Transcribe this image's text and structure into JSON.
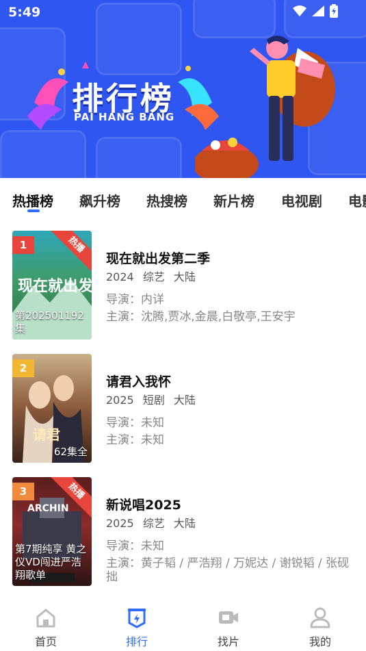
{
  "status_bar": {
    "time": "5:49"
  },
  "banner": {
    "title": "排行榜",
    "subtitle": "PAI HANG BANG"
  },
  "tabs": [
    {
      "label": "热播榜"
    },
    {
      "label": "飙升榜"
    },
    {
      "label": "热搜榜"
    },
    {
      "label": "新片榜"
    },
    {
      "label": "电视剧"
    },
    {
      "label": "电影"
    }
  ],
  "items": [
    {
      "rank": "1",
      "badge": "热播",
      "poster_caption": "第202501192集",
      "title": "现在就出发第二季",
      "year": "2024",
      "genre": "综艺",
      "region": "大陆",
      "director": "导演：内详",
      "cast": "主演：沈腾,贾冰,金晨,白敬亭,王安宇",
      "rank_color": "#e8453c"
    },
    {
      "rank": "2",
      "badge": "",
      "poster_caption": "62集全",
      "title": "请君入我怀",
      "year": "2025",
      "genre": "短剧",
      "region": "大陆",
      "director": "导演：未知",
      "cast": "主演：未知",
      "rank_color": "#f3b632"
    },
    {
      "rank": "3",
      "badge": "热播",
      "poster_caption": "第7期纯享 黄之仪VD闯进严浩翔歌单",
      "title": "新说唱2025",
      "year": "2025",
      "genre": "综艺",
      "region": "大陆",
      "director": "导演：未知",
      "cast": "主演：黄子韬 / 严浩翔 / 万妮达 / 谢锐韬 / 张砚拙",
      "rank_color": "#f08a3c"
    }
  ],
  "bottom_nav": [
    {
      "label": "首页",
      "icon": "home-icon"
    },
    {
      "label": "排行",
      "icon": "ranking-icon"
    },
    {
      "label": "找片",
      "icon": "video-camera-icon"
    },
    {
      "label": "我的",
      "icon": "user-icon"
    }
  ],
  "colors": {
    "accent": "#2f6bff",
    "banner": "#2f56f0"
  }
}
